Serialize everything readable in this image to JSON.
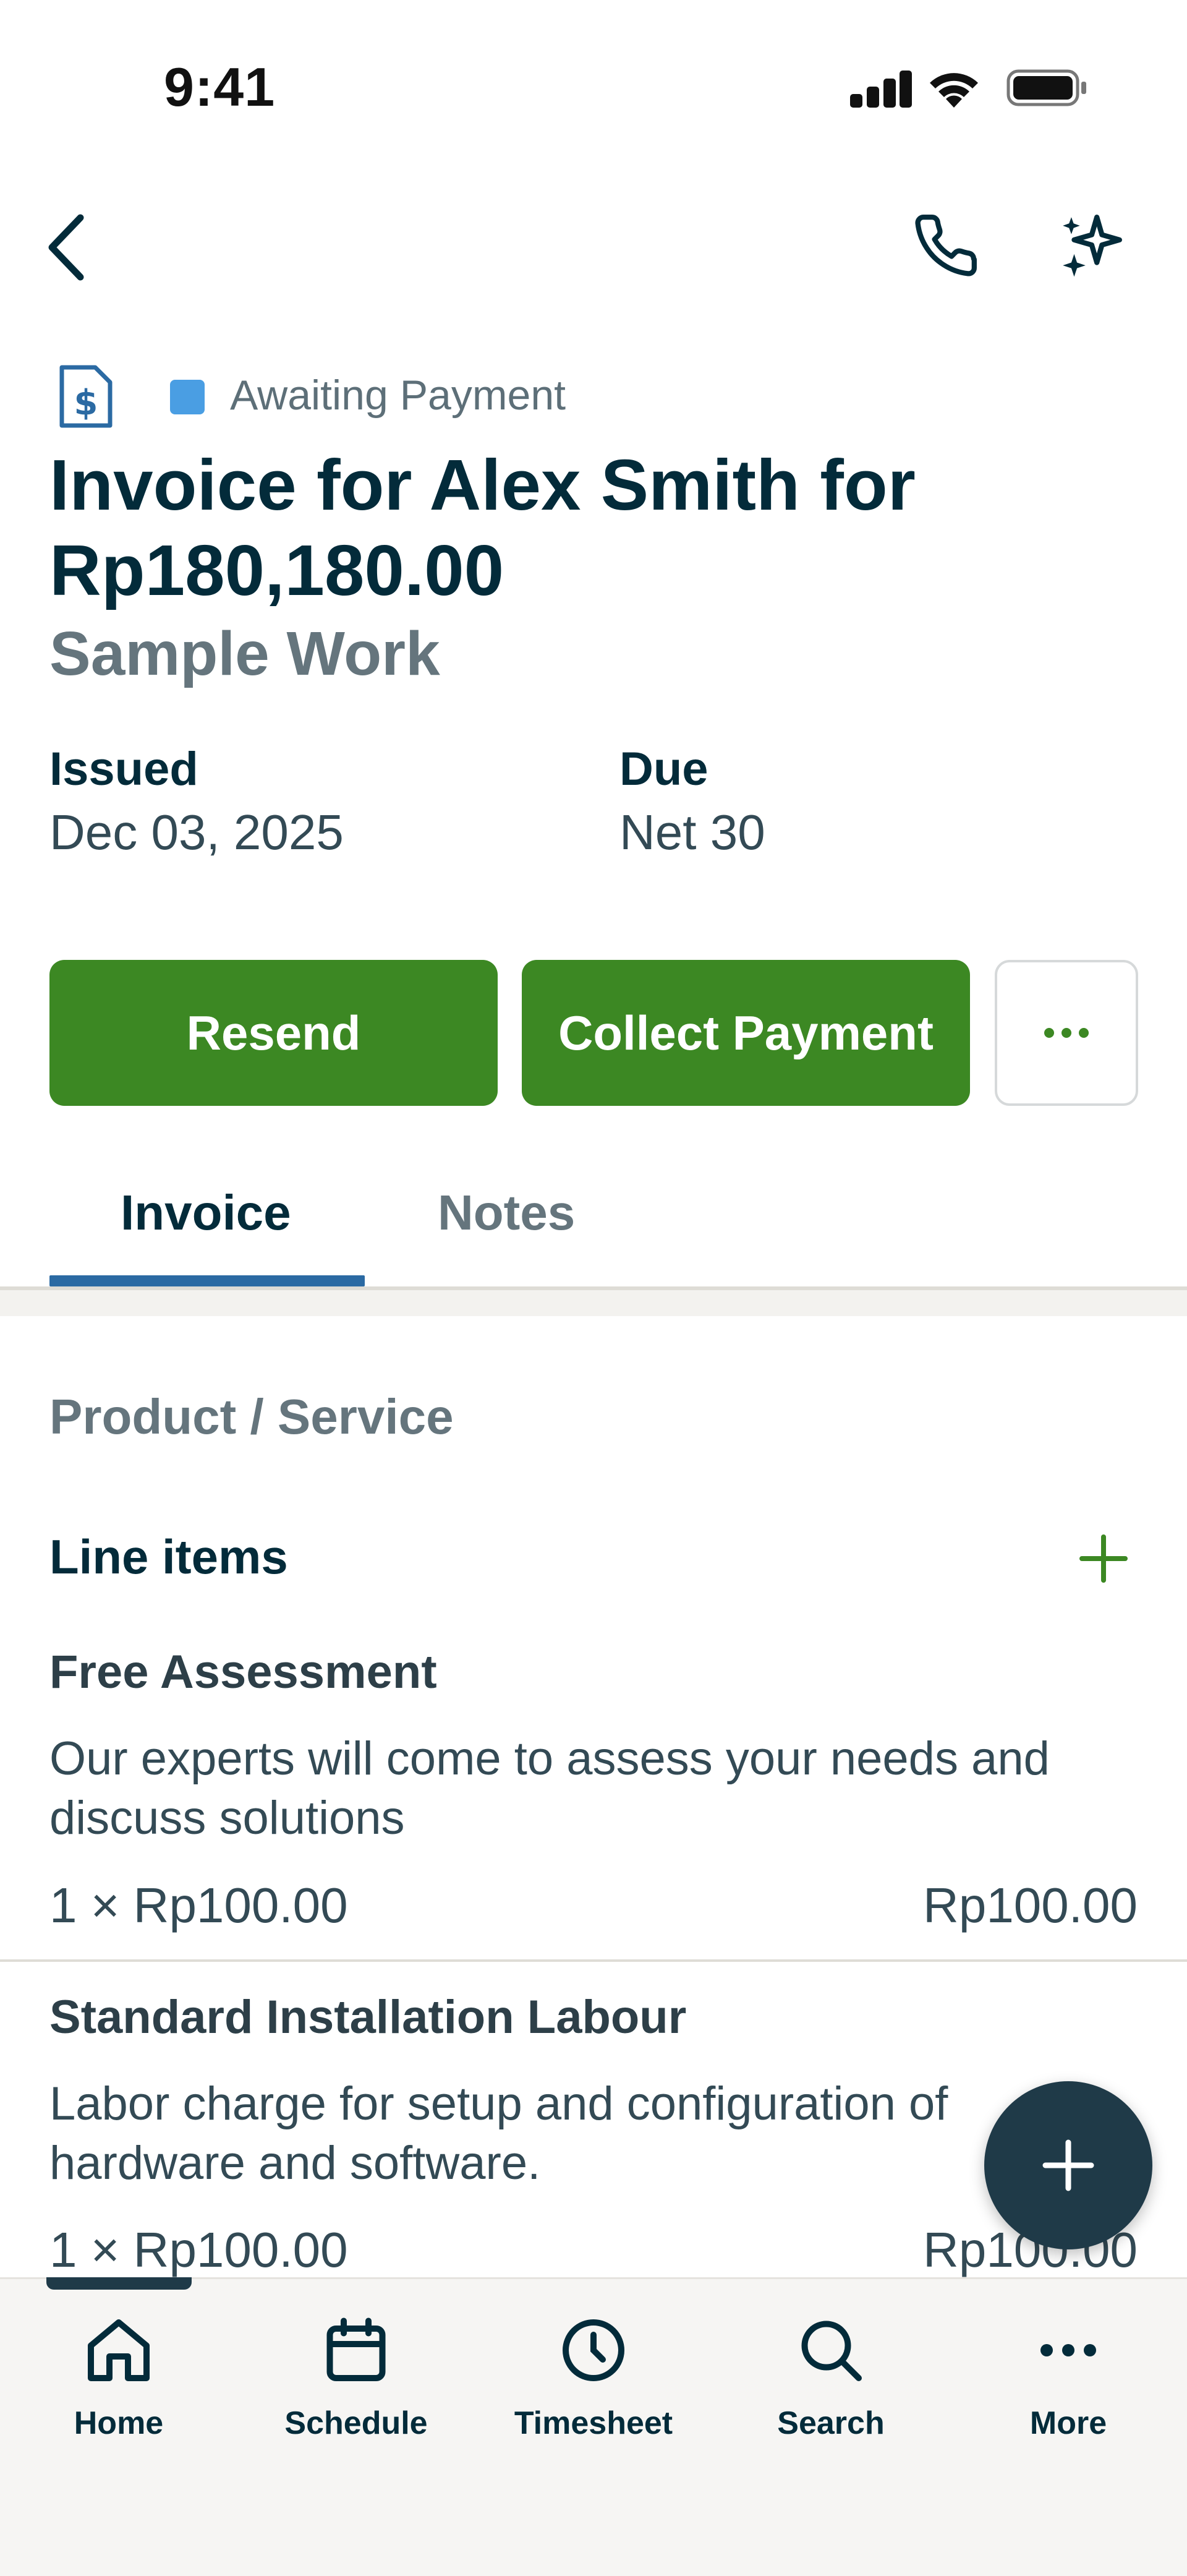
{
  "status_bar": {
    "time": "9:41"
  },
  "header": {
    "back_icon": "chevron-left-icon",
    "phone_icon": "phone-icon",
    "ai_icon": "sparkles-icon"
  },
  "invoice": {
    "status": "Awaiting Payment",
    "status_color": "#4a9ee3",
    "title": "Invoice for Alex Smith for Rp180,180.00",
    "subtitle": "Sample Work",
    "issued_label": "Issued",
    "issued_value": "Dec 03, 2025",
    "due_label": "Due",
    "due_value": "Net 30"
  },
  "actions": {
    "resend": "Resend",
    "collect_payment": "Collect Payment",
    "accent": "#3c8823"
  },
  "tabs": [
    {
      "label": "Invoice",
      "active": true
    },
    {
      "label": "Notes",
      "active": false
    }
  ],
  "section": {
    "heading": "Product / Service",
    "line_items_label": "Line items"
  },
  "line_items": [
    {
      "name": "Free Assessment",
      "description": "Our experts will come to assess your needs and discuss solutions",
      "quantity": "1 × Rp100.00",
      "total": "Rp100.00"
    },
    {
      "name": "Standard Installation Labour",
      "description": "Labor charge for setup and configuration of hardware and software.",
      "quantity": "1 × Rp100.00",
      "total": "Rp100.00"
    }
  ],
  "bottom_nav": [
    {
      "label": "Home",
      "icon": "home-icon",
      "active": true
    },
    {
      "label": "Schedule",
      "icon": "calendar-icon"
    },
    {
      "label": "Timesheet",
      "icon": "clock-icon"
    },
    {
      "label": "Search",
      "icon": "search-icon"
    },
    {
      "label": "More",
      "icon": "more-icon"
    }
  ]
}
